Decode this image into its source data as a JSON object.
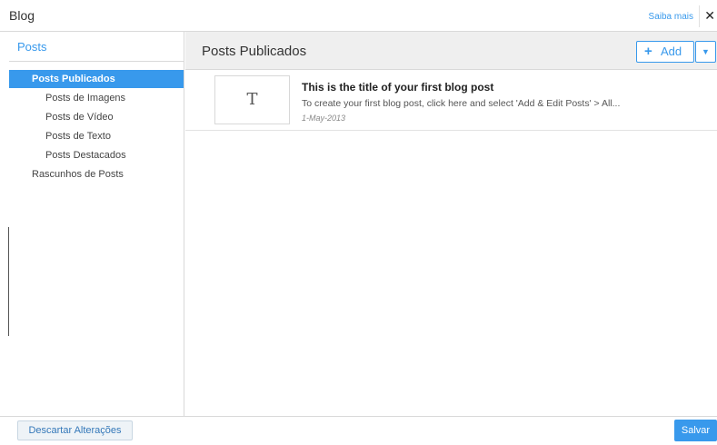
{
  "window": {
    "title": "Blog",
    "learn_more": "Saiba mais",
    "close_glyph": "✕"
  },
  "sidebar": {
    "header": "Posts",
    "items": [
      {
        "label": "Posts Publicados",
        "active": true
      },
      {
        "label": "Posts de Imagens"
      },
      {
        "label": "Posts de Vídeo"
      },
      {
        "label": "Posts de Texto"
      },
      {
        "label": "Posts Destacados"
      },
      {
        "label": "Rascunhos de Posts"
      }
    ]
  },
  "main": {
    "title": "Posts Publicados",
    "add_label": "Add",
    "add_icon": "plus-icon",
    "dropdown_icon": "caret-down-icon",
    "posts": [
      {
        "thumb_letter": "T",
        "title": "This is the title of your first blog post",
        "excerpt": "To create your first blog post, click here and select 'Add & Edit Posts' > All...",
        "date": "1-May-2013"
      }
    ]
  },
  "footer": {
    "discard_label": "Descartar Alterações",
    "save_label": "Salvar"
  },
  "colors": {
    "accent": "#3899ec",
    "header_bg": "#efefef",
    "border": "#d9d9d9"
  }
}
